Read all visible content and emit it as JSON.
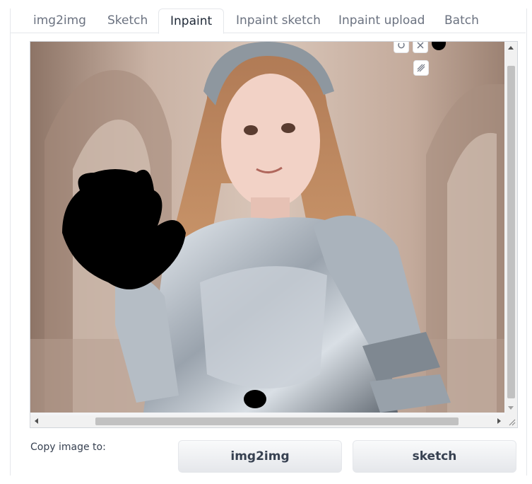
{
  "tabs": [
    {
      "label": "img2img",
      "active": false
    },
    {
      "label": "Sketch",
      "active": false
    },
    {
      "label": "Inpaint",
      "active": true
    },
    {
      "label": "Inpaint sketch",
      "active": false
    },
    {
      "label": "Inpaint upload",
      "active": false
    },
    {
      "label": "Batch",
      "active": false
    }
  ],
  "canvas": {
    "tools": [
      "undo-icon",
      "clear-icon",
      "brush-color-icon",
      "brush-size-icon"
    ]
  },
  "copy": {
    "label": "Copy image to:",
    "buttons": [
      "img2img",
      "sketch"
    ]
  },
  "colors": {
    "accent": "#1f2937",
    "mask": "#000000",
    "button_bg": "#eceef1"
  }
}
